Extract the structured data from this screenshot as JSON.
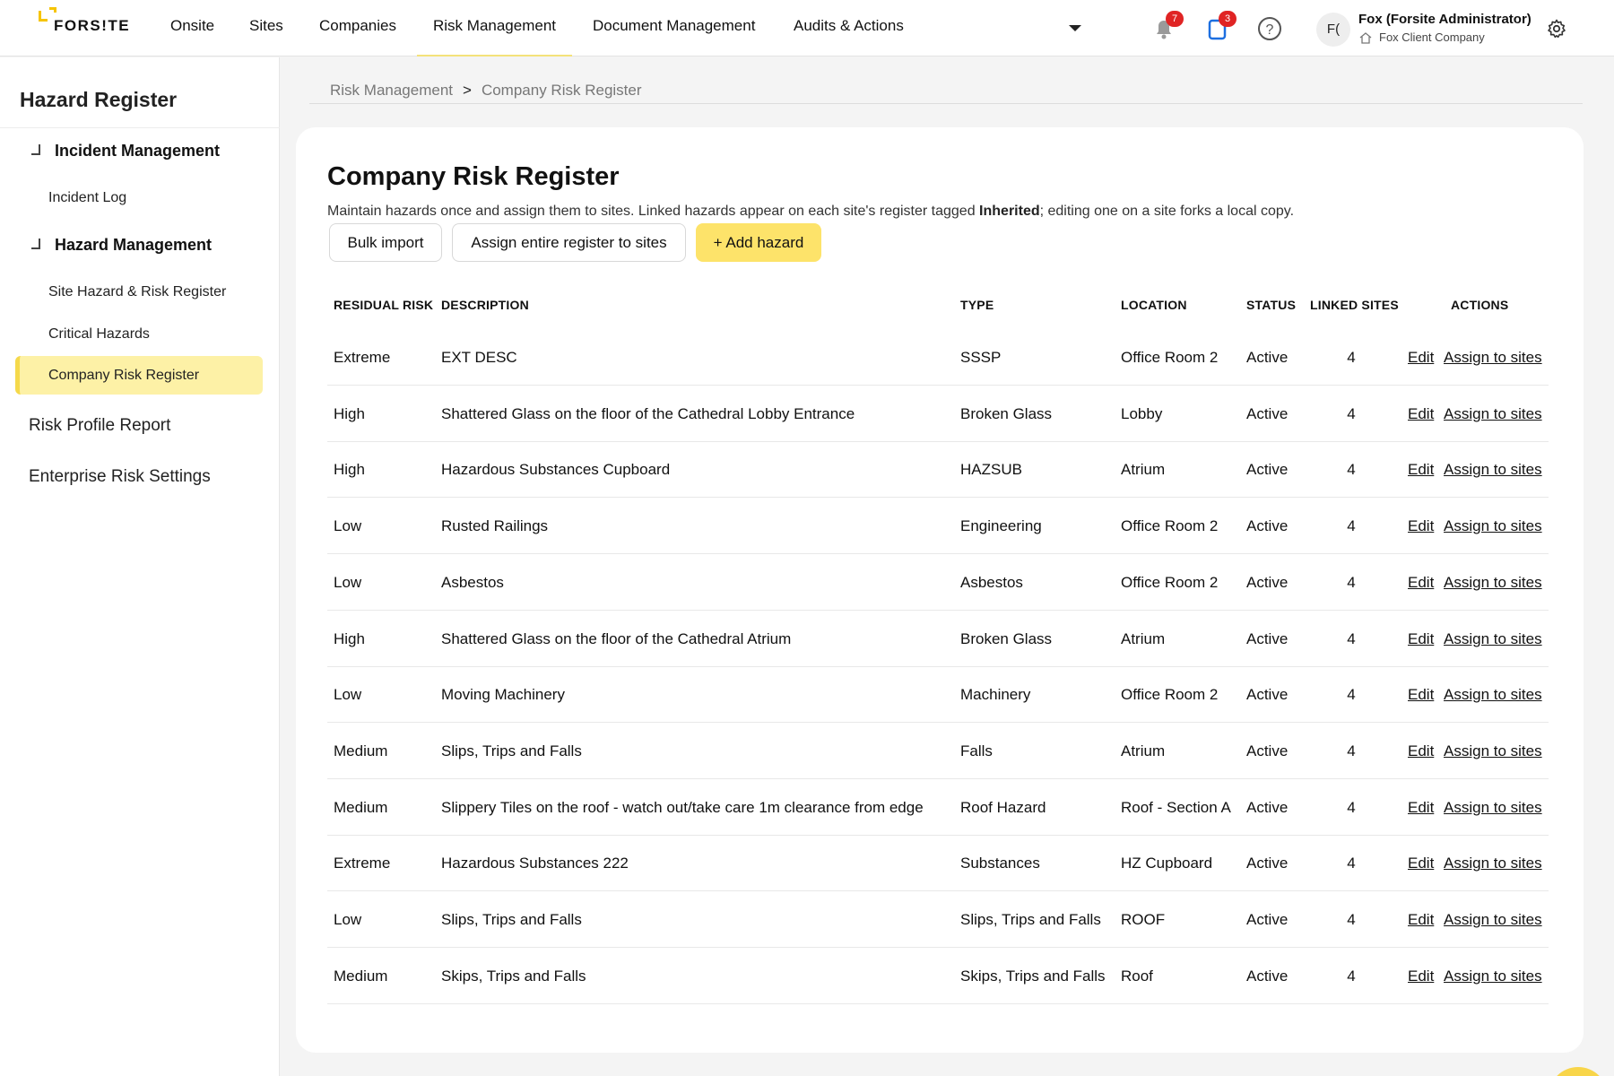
{
  "brand": {
    "logo_text": "FORS!TE",
    "accent": "#f6c400",
    "highlight": "#fdf1a6",
    "primary_button": "#fde36a"
  },
  "nav": {
    "items": [
      "Onsite",
      "Sites",
      "Companies",
      "Risk Management",
      "Document Management",
      "Audits & Actions"
    ],
    "active": "Risk Management",
    "notifications_count": "7",
    "tasks_count": "3",
    "help_icon": "question-circle-icon",
    "avatar_initials": "F(",
    "user_name": "Fox (Forsite Administrator)",
    "user_company": "Fox Client Company"
  },
  "sidebar": {
    "title": "Hazard Register",
    "sections": [
      {
        "label": "Incident Management",
        "items": [
          "Incident Log"
        ]
      },
      {
        "label": "Hazard Management",
        "items": [
          "Site Hazard & Risk Register",
          "Critical Hazards",
          "Company Risk Register"
        ]
      }
    ],
    "active_item": "Company Risk Register",
    "top_links": [
      "Risk Profile Report",
      "Enterprise Risk Settings"
    ]
  },
  "breadcrumb": {
    "parent": "Risk Management",
    "separator": ">",
    "current": "Company Risk Register"
  },
  "page": {
    "title": "Company Risk Register",
    "desc_before": "Maintain hazards once and assign them to sites. Linked hazards appear on each site's register tagged ",
    "desc_bold": "Inherited",
    "desc_after": "; editing one on a site forks a local copy.",
    "buttons": {
      "bulk": "Bulk import",
      "assign_all": "Assign entire register to sites",
      "add": "+ Add hazard"
    }
  },
  "table": {
    "headers": [
      "RESIDUAL RISK",
      "DESCRIPTION",
      "TYPE",
      "LOCATION",
      "STATUS",
      "LINKED SITES",
      "ACTIONS"
    ],
    "edit_label": "Edit",
    "assign_label": "Assign to sites",
    "rows": [
      [
        "Extreme",
        "EXT DESC",
        "SSSP",
        "Office Room 2",
        "Active",
        "4"
      ],
      [
        "High",
        "Shattered Glass on the floor of the Cathedral Lobby Entrance",
        "Broken Glass",
        "Lobby",
        "Active",
        "4"
      ],
      [
        "High",
        "Hazardous Substances Cupboard",
        "HAZSUB",
        "Atrium",
        "Active",
        "4"
      ],
      [
        "Low",
        "Rusted Railings",
        "Engineering",
        "Office Room 2",
        "Active",
        "4"
      ],
      [
        "Low",
        "Asbestos",
        "Asbestos",
        "Office Room 2",
        "Active",
        "4"
      ],
      [
        "High",
        "Shattered Glass on the floor of the Cathedral Atrium",
        "Broken Glass",
        "Atrium",
        "Active",
        "4"
      ],
      [
        "Low",
        "Moving Machinery",
        "Machinery",
        "Office Room 2",
        "Active",
        "4"
      ],
      [
        "Medium",
        "Slips, Trips and Falls",
        "Falls",
        "Atrium",
        "Active",
        "4"
      ],
      [
        "Medium",
        "Slippery Tiles on the roof - watch out/take care 1m clearance from edge",
        "Roof Hazard",
        "Roof - Section A",
        "Active",
        "4"
      ],
      [
        "Extreme",
        "Hazardous Substances 222",
        "Substances",
        "HZ Cupboard",
        "Active",
        "4"
      ],
      [
        "Low",
        "Slips, Trips and Falls",
        "Slips, Trips and Falls",
        "ROOF",
        "Active",
        "4"
      ],
      [
        "Medium",
        "Skips, Trips and Falls",
        "Skips, Trips and Falls",
        "Roof",
        "Active",
        "4"
      ]
    ]
  }
}
